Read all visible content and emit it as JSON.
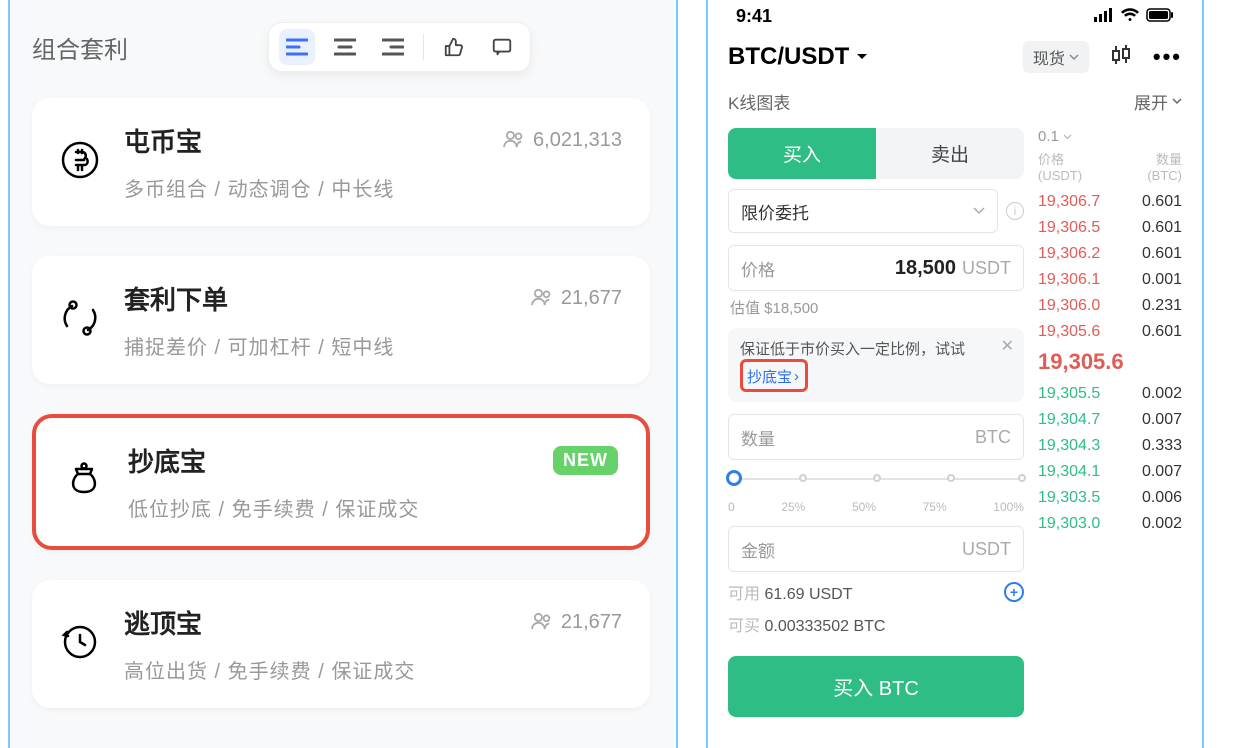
{
  "left": {
    "title": "组合套利",
    "cards": [
      {
        "icon": "bitcoin-icon",
        "title": "屯币宝",
        "users": "6,021,313",
        "sub": "多币组合 / 动态调仓 / 中长线",
        "new": false,
        "highlight": false
      },
      {
        "icon": "swap-icon",
        "title": "套利下单",
        "users": "21,677",
        "sub": "捕捉差价 / 可加杠杆 / 短中线",
        "new": false,
        "highlight": false
      },
      {
        "icon": "bag-icon",
        "title": "抄底宝",
        "users": "",
        "sub": "低位抄底 / 免手续费 / 保证成交",
        "new": true,
        "highlight": true
      },
      {
        "icon": "clock-arrow-icon",
        "title": "逃顶宝",
        "users": "21,677",
        "sub": "高位出货 / 免手续费 / 保证成交",
        "new": false,
        "highlight": false
      }
    ],
    "new_label": "NEW"
  },
  "right": {
    "time": "9:41",
    "pair": "BTC/USDT",
    "spot_label": "现货",
    "kline_label": "K线图表",
    "expand_label": "展开",
    "tabs": {
      "buy": "买入",
      "sell": "卖出"
    },
    "order_type": "限价委托",
    "price": {
      "label": "价格",
      "value": "18,500",
      "unit": "USDT"
    },
    "est": "估值 $18,500",
    "tip_text": "保证低于市价买入一定比例，试试",
    "tip_link": "抄底宝",
    "qty": {
      "label": "数量",
      "unit": "BTC"
    },
    "slider": [
      "0",
      "25%",
      "50%",
      "75%",
      "100%"
    ],
    "amount": {
      "label": "金额",
      "unit": "USDT"
    },
    "available": {
      "label": "可用",
      "value": "61.69 USDT"
    },
    "can_buy": {
      "label": "可买",
      "value": "0.00333502 BTC"
    },
    "buy_button": "买入 BTC",
    "orderbook": {
      "depth": "0.1",
      "price_hdr": "价格",
      "price_unit": "(USDT)",
      "qty_hdr": "数量",
      "qty_unit": "(BTC)",
      "asks": [
        {
          "p": "19,306.7",
          "q": "0.601"
        },
        {
          "p": "19,306.5",
          "q": "0.601"
        },
        {
          "p": "19,306.2",
          "q": "0.601"
        },
        {
          "p": "19,306.1",
          "q": "0.001"
        },
        {
          "p": "19,306.0",
          "q": "0.231"
        },
        {
          "p": "19,305.6",
          "q": "0.601"
        }
      ],
      "last": "19,305.6",
      "bids": [
        {
          "p": "19,305.5",
          "q": "0.002"
        },
        {
          "p": "19,304.7",
          "q": "0.007"
        },
        {
          "p": "19,304.3",
          "q": "0.333"
        },
        {
          "p": "19,304.1",
          "q": "0.007"
        },
        {
          "p": "19,303.5",
          "q": "0.006"
        },
        {
          "p": "19,303.0",
          "q": "0.002"
        }
      ]
    }
  }
}
